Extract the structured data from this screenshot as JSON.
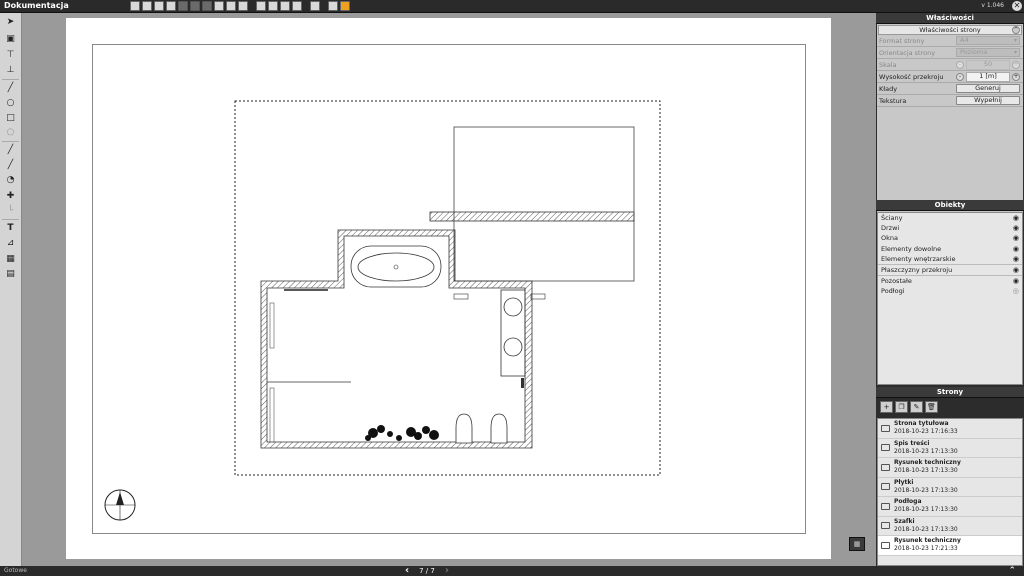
{
  "app": {
    "title": "Dokumentacja",
    "version": "v 1.046"
  },
  "status": {
    "text": "Gotowe"
  },
  "pager": {
    "label": "7 / 7"
  },
  "properties": {
    "title": "Właściwości",
    "subheader": "Właściwości strony",
    "rows": [
      {
        "label": "Format strony",
        "value": "A4"
      },
      {
        "label": "Orientacja strony",
        "value": "Pozioma"
      },
      {
        "label": "Skala",
        "value": "50"
      },
      {
        "label": "Wysokość przekroju",
        "value": "1 [m]"
      },
      {
        "label": "Kłady",
        "value": "Generuj"
      },
      {
        "label": "Tekstura",
        "value": "Wypełnij"
      }
    ]
  },
  "objects": {
    "title": "Obiekty",
    "items": [
      "Ściany",
      "Drzwi",
      "Okna",
      "Elementy dowolne",
      "Elementy wnętrzarskie",
      "Płaszczyzny przekroju",
      "Pozostałe",
      "Podłogi"
    ]
  },
  "pages": {
    "title": "Strony",
    "items": [
      {
        "name": "Strona tytułowa",
        "date": "2018-10-23 17:16:33"
      },
      {
        "name": "Spis treści",
        "date": "2018-10-23 17:13:30"
      },
      {
        "name": "Rysunek techniczny",
        "date": "2018-10-23 17:13:30"
      },
      {
        "name": "Płytki",
        "date": "2018-10-23 17:13:30"
      },
      {
        "name": "Podłoga",
        "date": "2018-10-23 17:13:30"
      },
      {
        "name": "Szafki",
        "date": "2018-10-23 17:13:30"
      },
      {
        "name": "Rysunek techniczny",
        "date": "2018-10-23 17:21:33"
      }
    ]
  },
  "colors": {
    "accent": "#f0a020",
    "panel": "#2c2c2c",
    "toolbar": "#2a2a2a"
  },
  "icons": {
    "left_tools": [
      "pointer-icon",
      "text-frame-icon",
      "align-top-icon",
      "align-bottom-icon",
      "line-icon",
      "circle-icon",
      "rectangle-icon",
      "polygon-icon",
      "dimension-icon",
      "dimension-angle-icon",
      "arc-icon",
      "vertical-dimension-icon",
      "corner-dimension-icon",
      "text-icon",
      "level-icon",
      "table-icon",
      "stamp-icon"
    ]
  }
}
